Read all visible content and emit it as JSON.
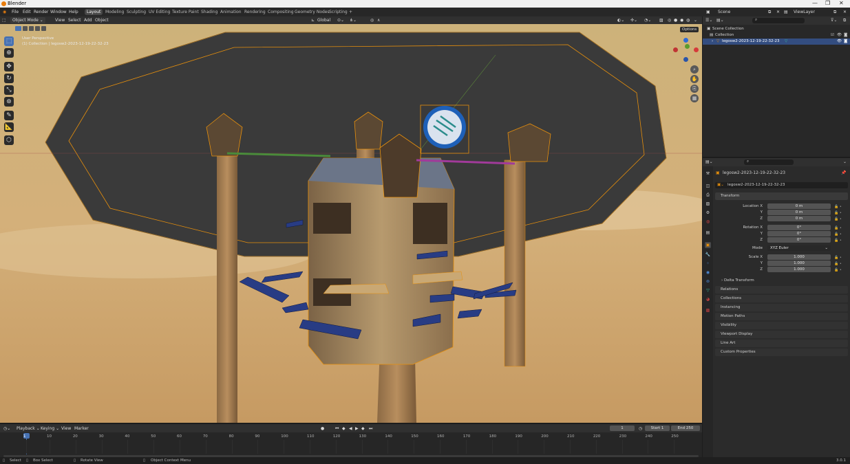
{
  "app": {
    "title": "Blender",
    "version": "3.0.1"
  },
  "menu": {
    "items": [
      "File",
      "Edit",
      "Render",
      "Window",
      "Help"
    ]
  },
  "workspaces": [
    "Layout",
    "Modeling",
    "Sculpting",
    "UV Editing",
    "Texture Paint",
    "Shading",
    "Animation",
    "Rendering",
    "Compositing",
    "Geometry Nodes",
    "Scripting",
    "+"
  ],
  "active_workspace": "Layout",
  "scene": {
    "name": "Scene",
    "view_layer": "ViewLayer"
  },
  "viewport_header": {
    "mode": "Object Mode",
    "menus": [
      "View",
      "Select",
      "Add",
      "Object"
    ],
    "orientation": "Global",
    "options_label": "Options"
  },
  "viewport": {
    "perspective_label": "User Perspective",
    "collection_label": "(1) Collection | legosw2-2023-12-19-22-32-23"
  },
  "outliner": {
    "scene_collection": "Scene Collection",
    "collection": "Collection",
    "object": "legosw2-2023-12-19-22-32-23"
  },
  "properties": {
    "object_name": "legosw2-2023-12-19-22-32-23",
    "data_name": "legosw2-2023-12-19-22-32-23",
    "transform_title": "Transform",
    "location_label": "Location X",
    "rotation_label": "Rotation X",
    "scale_label": "Scale X",
    "y_label": "Y",
    "z_label": "Z",
    "location": [
      "0 m",
      "0 m",
      "0 m"
    ],
    "rotation": [
      "0°",
      "0°",
      "0°"
    ],
    "mode_label": "Mode",
    "mode_value": "XYZ Euler",
    "scale": [
      "1.000",
      "1.000",
      "1.000"
    ],
    "delta_transform": "Delta Transform",
    "panels": [
      "Relations",
      "Collections",
      "Instancing",
      "Motion Paths",
      "Visibility",
      "Viewport Display",
      "Line Art",
      "Custom Properties"
    ]
  },
  "timeline": {
    "menus": [
      "Playback",
      "Keying",
      "View",
      "Marker"
    ],
    "current_frame": "1",
    "start_label": "Start",
    "start": "1",
    "end_label": "End",
    "end": "250",
    "ticks": [
      "1",
      "10",
      "20",
      "30",
      "40",
      "50",
      "60",
      "70",
      "80",
      "90",
      "100",
      "110",
      "120",
      "130",
      "140",
      "150",
      "160",
      "170",
      "180",
      "190",
      "200",
      "210",
      "220",
      "230",
      "240",
      "250"
    ]
  },
  "statusbar": {
    "items": [
      "Select",
      "Box Select",
      "Rotate View",
      "Object Context Menu"
    ]
  },
  "colors": {
    "accent": "#4772b3",
    "selection": "#e8900c",
    "background": "#1d1d1d"
  }
}
